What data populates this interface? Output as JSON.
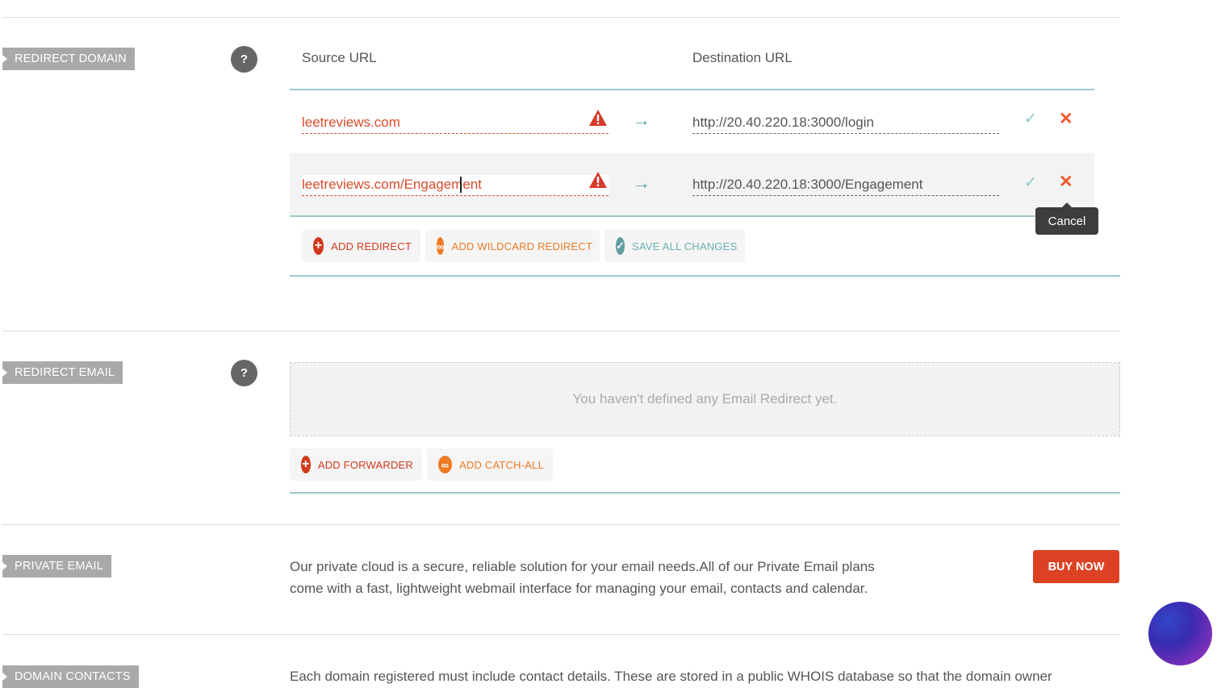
{
  "redirect_domain": {
    "tag": "REDIRECT DOMAIN",
    "help": "?",
    "source_header": "Source URL",
    "destination_header": "Destination URL",
    "rows": [
      {
        "source": "leetreviews.com",
        "destination": "http://20.40.220.18:3000/login"
      },
      {
        "source": "leetreviews.com/Engagement",
        "destination": "http://20.40.220.18:3000/Engagement"
      }
    ],
    "arrow": "→",
    "ok_glyph": "✓",
    "cancel_glyph": "✕",
    "tooltip": "Cancel",
    "buttons": {
      "add_redirect": "ADD REDIRECT",
      "add_wildcard": "ADD WILDCARD REDIRECT",
      "save_all": "SAVE ALL CHANGES"
    }
  },
  "redirect_email": {
    "tag": "REDIRECT EMAIL",
    "help": "?",
    "empty_message": "You haven't defined any Email Redirect yet.",
    "buttons": {
      "add_forwarder": "ADD FORWARDER",
      "add_catch_all": "ADD CATCH-ALL"
    }
  },
  "private_email": {
    "tag": "PRIVATE EMAIL",
    "line1": "Our private cloud is a secure, reliable solution for your email needs.All of our Private Email plans",
    "line2": "come with a fast, lightweight webmail interface for managing your email, contacts and calendar.",
    "buy_label": "BUY NOW"
  },
  "domain_contacts": {
    "tag": "DOMAIN CONTACTS",
    "text": "Each domain registered must include contact details. These are stored in a public WHOIS database so that the domain owner"
  },
  "colors": {
    "accent_red": "#dd4124",
    "teal": "#9cc7cb",
    "orange": "#ee7a23"
  }
}
